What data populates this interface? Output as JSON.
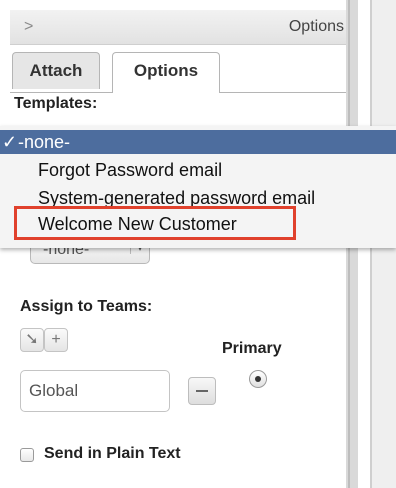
{
  "header": {
    "title": "Options",
    "chevron_icon": "chevron-right-icon"
  },
  "tabs": [
    {
      "label": "Attach"
    },
    {
      "label": "Options"
    }
  ],
  "templates": {
    "label": "Templates:",
    "options": [
      {
        "label": "-none-",
        "selected": true,
        "check": "✓"
      },
      {
        "label": "Forgot Password email"
      },
      {
        "label": "System-generated password email"
      },
      {
        "label": "Welcome New Customer",
        "highlighted": true
      }
    ],
    "highlight_color": "#e0412c",
    "selected_color": "#4d6d9e"
  },
  "secondary_select": {
    "value": "-none-",
    "arrow": "▾"
  },
  "teams": {
    "label": "Assign to Teams:",
    "select_icon": "cursor-arrow-icon",
    "add_icon": "plus-icon",
    "primary_label": "Primary",
    "input_value": "Global"
  },
  "plain_text": {
    "label": "Send in Plain Text",
    "checked": false
  }
}
